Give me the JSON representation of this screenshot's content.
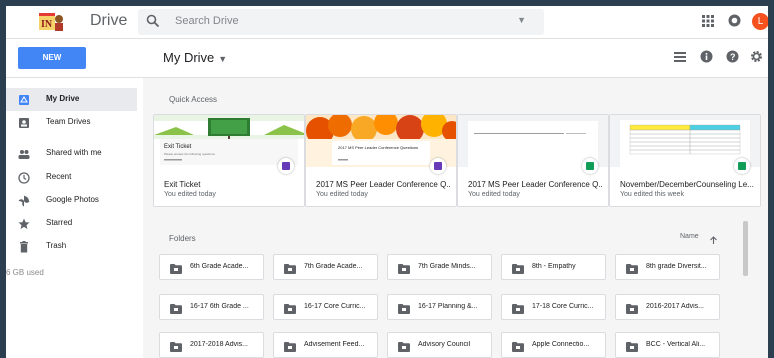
{
  "app": {
    "name": "Drive",
    "logo_text": "IN"
  },
  "search": {
    "placeholder": "Search Drive"
  },
  "user": {
    "initial": "L"
  },
  "toolbar": {
    "new_label": "NEW",
    "title": "My Drive"
  },
  "sidebar": {
    "items": [
      {
        "label": "My Drive",
        "icon": "drive-icon",
        "active": true
      },
      {
        "label": "Team Drives",
        "icon": "team-drives-icon"
      },
      {
        "label": "Shared with me",
        "icon": "people-icon"
      },
      {
        "label": "Recent",
        "icon": "clock-icon"
      },
      {
        "label": "Google Photos",
        "icon": "pinwheel-icon"
      },
      {
        "label": "Starred",
        "icon": "star-icon"
      },
      {
        "label": "Trash",
        "icon": "trash-icon"
      }
    ],
    "storage": "6 GB used"
  },
  "quick_access": {
    "label": "Quick Access",
    "cards": [
      {
        "title": "Exit Ticket",
        "subtitle": "You edited today",
        "type": "forms",
        "thumb_title": "Exit Ticket",
        "thumb_text": "Please answer the following questions"
      },
      {
        "title": "2017 MS Peer Leader Conference Q...",
        "subtitle": "You edited today",
        "type": "forms",
        "thumb_title": "2017 MS Peer Leader Conference Questions"
      },
      {
        "title": "2017 MS Peer Leader Conference Q...",
        "subtitle": "You edited today",
        "type": "sheets"
      },
      {
        "title": "November/DecemberCounseling Le...",
        "subtitle": "You edited this week",
        "type": "sheets"
      }
    ]
  },
  "folders": {
    "label": "Folders",
    "sort_label": "Name",
    "items": [
      "6th Grade Acade...",
      "7th Grade Acade...",
      "7th Grade Minds...",
      "8th - Empathy",
      "8th grade Diversit...",
      "16-17 6th Grade ...",
      "16-17 Core Curric...",
      "16-17 Planning &...",
      "17-18 Core Curric...",
      "2016-2017 Advis...",
      "2017-2018 Advis...",
      "Advisement Feed...",
      "Advisory Council",
      "Apple Connectio...",
      "BCC - Vertical Ali..."
    ]
  },
  "colors": {
    "accent": "#4285f4",
    "forms": "#673ab7",
    "sheets": "#0f9d58",
    "avatar": "#f4511e",
    "frame": "#2b3f50"
  }
}
